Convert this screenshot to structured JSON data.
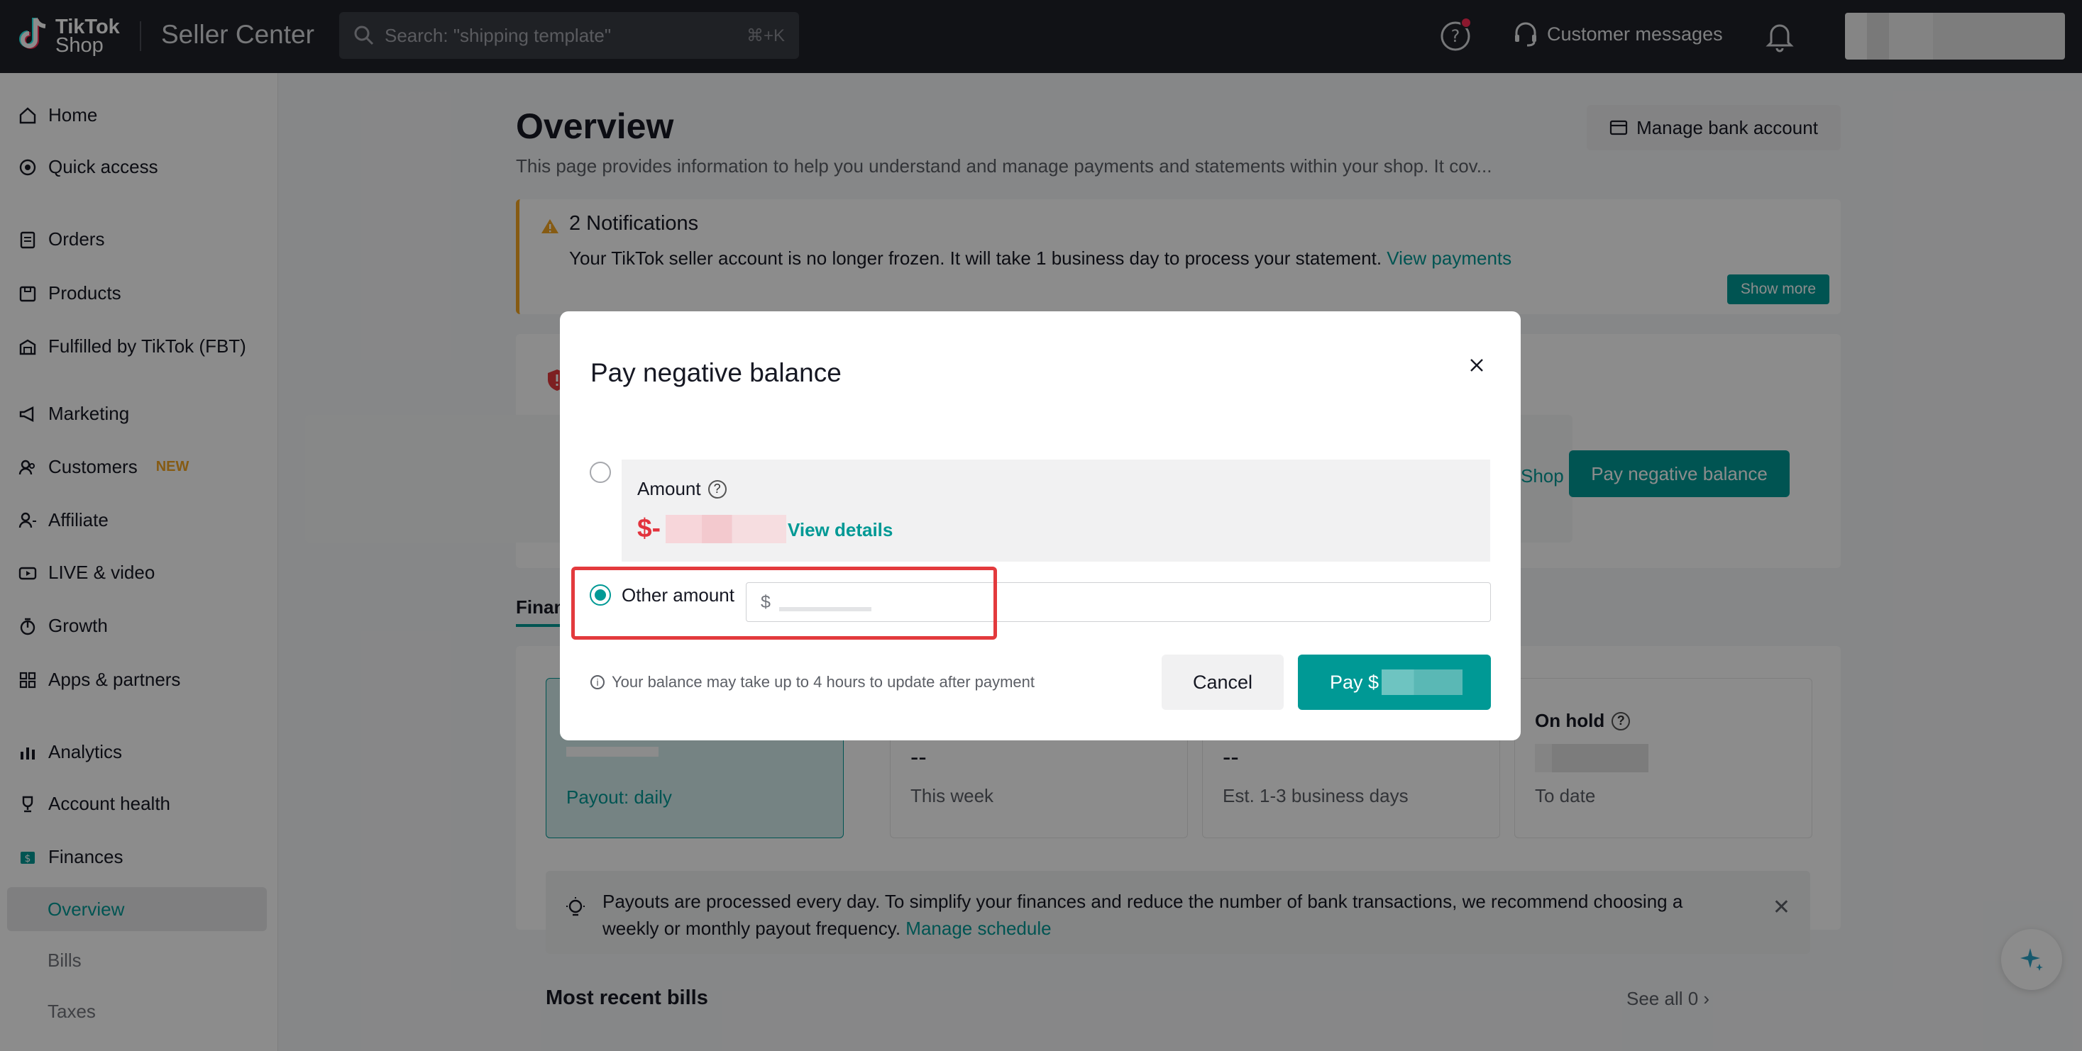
{
  "topbar": {
    "logo_line1": "TikTok",
    "logo_line2": "Shop",
    "product": "Seller Center",
    "search_placeholder": "Search: \"shipping template\"",
    "search_shortcut": "⌘+K",
    "customer_messages": "Customer messages"
  },
  "sidebar": {
    "items": [
      {
        "label": "Home",
        "icon": "home-icon"
      },
      {
        "label": "Quick access",
        "icon": "quick-access-icon"
      },
      {
        "label": "Orders",
        "icon": "orders-icon"
      },
      {
        "label": "Products",
        "icon": "products-icon"
      },
      {
        "label": "Fulfilled by TikTok (FBT)",
        "icon": "warehouse-icon"
      },
      {
        "label": "Marketing",
        "icon": "megaphone-icon"
      },
      {
        "label": "Customers",
        "icon": "customers-icon",
        "badge": "NEW"
      },
      {
        "label": "Affiliate",
        "icon": "affiliate-icon"
      },
      {
        "label": "LIVE & video",
        "icon": "video-icon"
      },
      {
        "label": "Growth",
        "icon": "growth-icon"
      },
      {
        "label": "Apps & partners",
        "icon": "apps-icon"
      },
      {
        "label": "Analytics",
        "icon": "analytics-icon"
      },
      {
        "label": "Account health",
        "icon": "trophy-icon"
      },
      {
        "label": "Finances",
        "icon": "finances-icon"
      }
    ],
    "sub_items": [
      "Overview",
      "Bills",
      "Taxes"
    ]
  },
  "main": {
    "title": "Overview",
    "description": "This page provides information to help you understand and manage payments and statements within your shop. It cov...",
    "manage_bank": "Manage bank account",
    "notifications": {
      "title": "2 Notifications",
      "body": "Your TikTok seller account is no longer frozen. It will take 1 business day to process your statement.",
      "link": "View payments",
      "show_more": "Show more"
    },
    "shop_link": "Shop",
    "pay_negative_balance": "Pay negative balance",
    "tab_partial": "Finan",
    "stats": [
      {
        "label": "",
        "value": "",
        "sub": "Payout: daily"
      },
      {
        "label": "",
        "value": "--",
        "sub": "This week"
      },
      {
        "label": "",
        "value": "--",
        "sub": "Est. 1-3 business days"
      },
      {
        "label": "On hold",
        "value": "",
        "sub": "To date"
      }
    ],
    "payout_note": "Payouts are processed every day. To simplify your finances and reduce the number of bank transactions, we recommend choosing a weekly or monthly payout frequency.",
    "manage_schedule": "Manage schedule",
    "recent_bills": "Most recent bills",
    "see_all": "See all 0"
  },
  "modal": {
    "title": "Pay negative balance",
    "amount_label": "Amount",
    "amount_prefix": "$-",
    "view_details": "View details",
    "other_amount": "Other amount",
    "currency": "$",
    "note": "Your balance may take up to 4 hours to update after payment",
    "cancel": "Cancel",
    "pay_prefix": "Pay $",
    "accent": "#009995",
    "highlight": "#e33a3d"
  }
}
